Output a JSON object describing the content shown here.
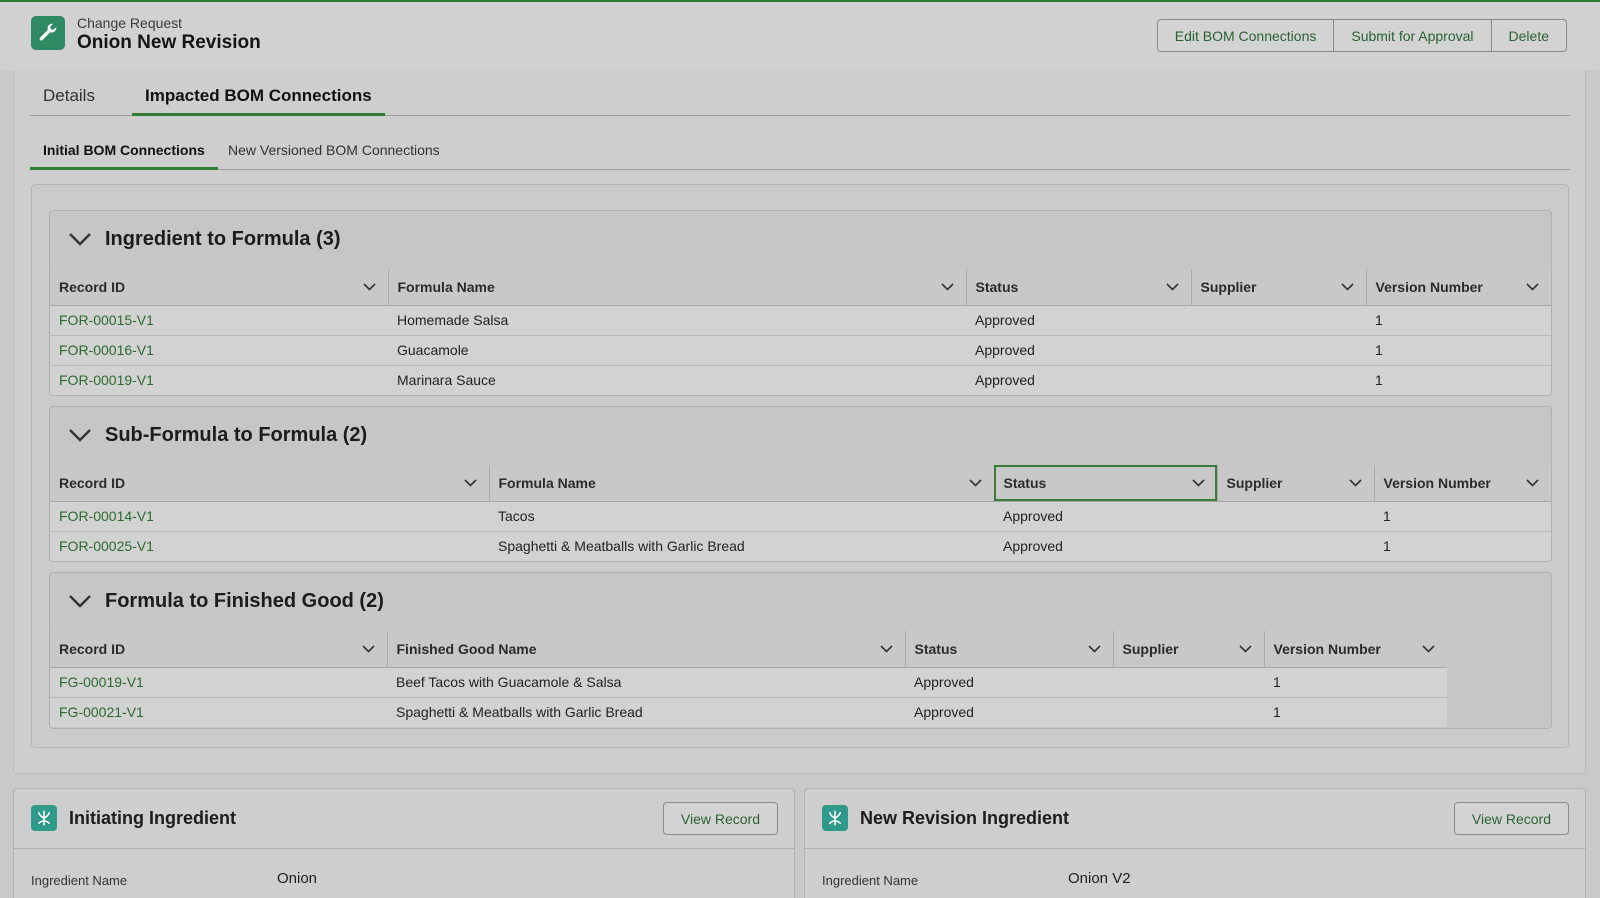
{
  "header": {
    "object_label": "Change Request",
    "record_title": "Onion New Revision",
    "actions": [
      "Edit BOM Connections",
      "Submit for Approval",
      "Delete"
    ]
  },
  "tabs": {
    "details": "Details",
    "impacted": "Impacted BOM Connections"
  },
  "subtabs": {
    "initial": "Initial BOM Connections",
    "new_versioned": "New Versioned BOM Connections"
  },
  "sections": {
    "ing_to_formula": {
      "title": "Ingredient to Formula (3)",
      "columns": [
        "Record ID",
        "Formula Name",
        "Status",
        "Supplier",
        "Version Number"
      ],
      "rows": [
        [
          "FOR-00015-V1",
          "Homemade Salsa",
          "Approved",
          "",
          "1"
        ],
        [
          "FOR-00016-V1",
          "Guacamole",
          "Approved",
          "",
          "1"
        ],
        [
          "FOR-00019-V1",
          "Marinara Sauce",
          "Approved",
          "",
          "1"
        ]
      ]
    },
    "sub_to_formula": {
      "title": "Sub-Formula to Formula (2)",
      "columns": [
        "Record ID",
        "Formula Name",
        "Status",
        "Supplier",
        "Version Number"
      ],
      "rows": [
        [
          "FOR-00014-V1",
          "Tacos",
          "Approved",
          "",
          "1"
        ],
        [
          "FOR-00025-V1",
          "Spaghetti & Meatballs with Garlic Bread",
          "Approved",
          "",
          "1"
        ]
      ]
    },
    "formula_to_fg": {
      "title": "Formula to Finished Good (2)",
      "columns": [
        "Record ID",
        "Finished Good Name",
        "Status",
        "Supplier",
        "Version Number"
      ],
      "rows": [
        [
          "FG-00019-V1",
          "Beef Tacos with Guacamole & Salsa",
          "Approved",
          "",
          "1"
        ],
        [
          "FG-00021-V1",
          "Spaghetti & Meatballs with Garlic Bread",
          "Approved",
          "",
          "1"
        ]
      ]
    }
  },
  "initiating": {
    "title": "Initiating Ingredient",
    "button": "View Record",
    "field_label": "Ingredient Name",
    "field_value": "Onion"
  },
  "new_revision": {
    "title": "New Revision Ingredient",
    "button": "View Record",
    "field_label": "Ingredient Name",
    "field_value": "Onion V2"
  },
  "colors": {
    "accent": "#2e7d32",
    "link": "#2b6a2f",
    "app_icon": "#2f8a63",
    "ingredient_icon": "#2f9a8a"
  },
  "icons": {
    "app": "wrench-icon",
    "ingredient": "ingredient-icon",
    "collapse": "chevron-down-icon",
    "column_menu": "chevron-down-icon"
  }
}
